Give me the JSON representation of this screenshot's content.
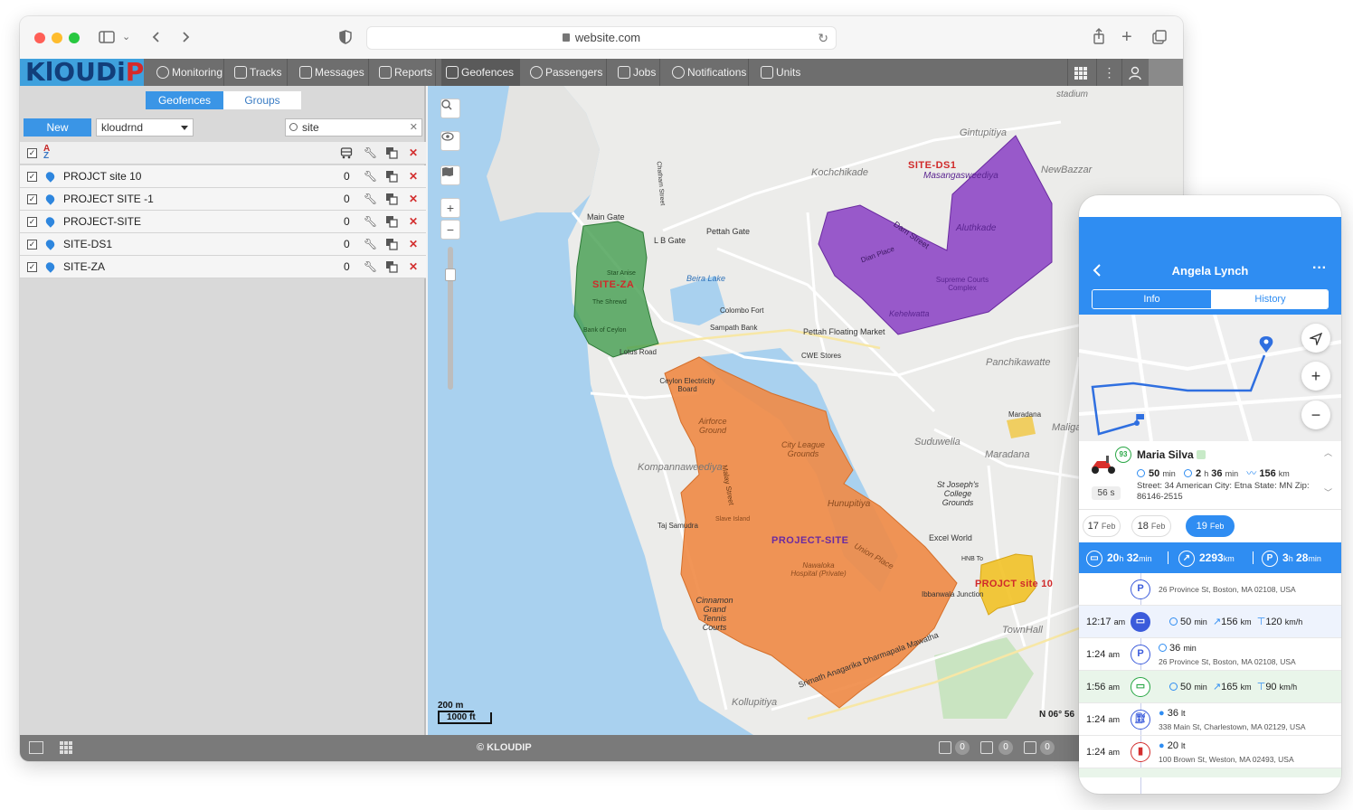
{
  "browser": {
    "url": "website.com"
  },
  "app": {
    "logo": "KlOUDiP",
    "nav": [
      {
        "label": "Monitoring"
      },
      {
        "label": "Tracks"
      },
      {
        "label": "Messages"
      },
      {
        "label": "Reports"
      },
      {
        "label": "Geofences",
        "active": true
      },
      {
        "label": "Passengers"
      },
      {
        "label": "Jobs"
      },
      {
        "label": "Notifications"
      },
      {
        "label": "Units"
      }
    ],
    "copyright": "© KLOUDIP",
    "status_counts": [
      "0",
      "0",
      "0"
    ]
  },
  "geofence_panel": {
    "tabs": {
      "geofences": "Geofences",
      "groups": "Groups"
    },
    "new_button": "New",
    "account_select": "kloudrnd",
    "search_value": "site",
    "items": [
      {
        "name": "PROJCT site 10",
        "count": "0"
      },
      {
        "name": "PROJECT SITE -1",
        "count": "0"
      },
      {
        "name": "PROJECT-SITE",
        "count": "0"
      },
      {
        "name": "SITE-DS1",
        "count": "0"
      },
      {
        "name": "SITE-ZA",
        "count": "0"
      }
    ]
  },
  "map": {
    "geofence_labels": {
      "za": "SITE-ZA",
      "ds1": "SITE-DS1",
      "project": "PROJECT-SITE",
      "site10": "PROJCT site 10"
    },
    "place_labels": {
      "gintupitiya": "Gintupitiya",
      "kochchikade": "Kochchikade",
      "newbazaar": "NewBazzar",
      "stadium": "stadium",
      "mainGate": "Main Gate",
      "lbGate": "L B Gate",
      "pettahGate": "Pettah Gate",
      "beiraLake": "Beira Lake",
      "colomboFort": "Colombo Fort",
      "sampathBank": "Sampath Bank",
      "pettahMarket": "Pettah Floating Market",
      "cweStores": "CWE Stores",
      "lotusRoad": "Lotus Road",
      "panchikawatte": "Panchikawatte",
      "maradana": "Maradana",
      "maligawatta": "Maligaw",
      "suduwella": "Suduwella",
      "maradanaArea": "Maradana",
      "kompannaveediya": "Kompannaweediya",
      "cityLeague": "City League Grounds",
      "hunupitiya": "Hunupitiya",
      "unionPlace": "Union Place",
      "stJosephs": "St Joseph's College Grounds",
      "excelWorld": "Excel World",
      "townHall": "TownHall",
      "kollupitiya": "Kollupitiya",
      "cinnamonGrand": "Cinnamon Grand Tennis Courts",
      "dharmapala": "Srimath Anagarika Dharmapala Mawatha",
      "aluthkade": "Aluthkade",
      "kehelwatta": "Kehelwatta",
      "supremeCourts": "Supreme Courts Complex",
      "mahangaweediya": "Masangasweediya",
      "damStreet": "Dam Street",
      "dianPlace": "Dian Place",
      "ceylonElectricity": "Ceylon Electricity Board",
      "airforceGround": "Airforce Ground",
      "nawaloka": "Nawaloka Hospital (Private)",
      "ibbanwala": "Ibbanwala Junction",
      "hnb": "HNB To",
      "tajSamudra": "Taj Samudra",
      "slaveIsland": "Slave Island",
      "malayStreet": "Malay Street",
      "chathamStreet": "Chatham Street",
      "bankOfCeylon": "Bank of Ceylon",
      "theShrewd": "The Shrewd",
      "galleFace": "Star Anise"
    },
    "scale": {
      "meters": "200 m",
      "feet": "1000 ft"
    },
    "coord": "N 06° 56"
  },
  "mobile": {
    "title": "Angela Lynch",
    "tabs": {
      "info": "Info",
      "history": "History"
    },
    "driver": {
      "name": "Maria Silva",
      "speed_badge": "93",
      "duration": "50",
      "duration_unit": "min",
      "total_h": "2",
      "total_m": "36",
      "total_unit_h": "h",
      "total_unit_m": "min",
      "distance": "156",
      "distance_unit": "km",
      "address": "Street: 34 American City: Etna State: MN Zip: 86146-2515",
      "age": "56 s"
    },
    "dates": [
      {
        "day": "17",
        "month": "Feb"
      },
      {
        "day": "18",
        "month": "Feb"
      },
      {
        "day": "19",
        "month": "Feb",
        "selected": true
      }
    ],
    "summary": {
      "drive": "20",
      "drive_h": "h",
      "drive_m": "32",
      "drive_mu": "min",
      "distance": "2293",
      "distance_u": "km",
      "parking": "3",
      "parking_h": "h",
      "parking_m": "28",
      "parking_mu": "min"
    },
    "timeline": [
      {
        "type": "parking",
        "address": "26 Province St, Boston, MA 02108, USA"
      },
      {
        "type": "drive",
        "time": "12:17",
        "ampm": "am",
        "dur": "50",
        "dur_u": "min",
        "dist": "156",
        "dist_u": "km",
        "speed": "120",
        "speed_u": "km/h"
      },
      {
        "type": "parking",
        "time": "1:24",
        "ampm": "am",
        "dur": "36",
        "dur_u": "min",
        "address": "26 Province St, Boston, MA 02108, USA"
      },
      {
        "type": "drive",
        "time": "1:56",
        "ampm": "am",
        "dur": "50",
        "dur_u": "min",
        "dist": "165",
        "dist_u": "km",
        "speed": "90",
        "speed_u": "km/h"
      },
      {
        "type": "fuel",
        "time": "1:24",
        "ampm": "am",
        "vol": "36",
        "vol_u": "lt",
        "address": "338 Main St, Charlestown, MA 02129, USA"
      },
      {
        "type": "fuel",
        "time": "1:24",
        "ampm": "am",
        "vol": "20",
        "vol_u": "lt",
        "address": "100 Brown St, Weston, MA 02493, USA"
      }
    ]
  },
  "colors": {
    "accent": "#2f8df2",
    "nav_bg": "#6e6e6e",
    "za": "#3f9b4a",
    "ds1": "#8a3fc4",
    "project": "#ef8a45",
    "site10": "#f2c227"
  },
  "icons": [
    "lock-icon",
    "reload-icon",
    "sidebar-toggle-icon",
    "back-icon",
    "forward-icon",
    "share-icon",
    "plus-icon",
    "tabs-icon",
    "search-icon",
    "eye-icon",
    "map-icon",
    "zoom-in-icon",
    "zoom-out-icon",
    "grid-icon",
    "more-icon",
    "user-icon"
  ]
}
